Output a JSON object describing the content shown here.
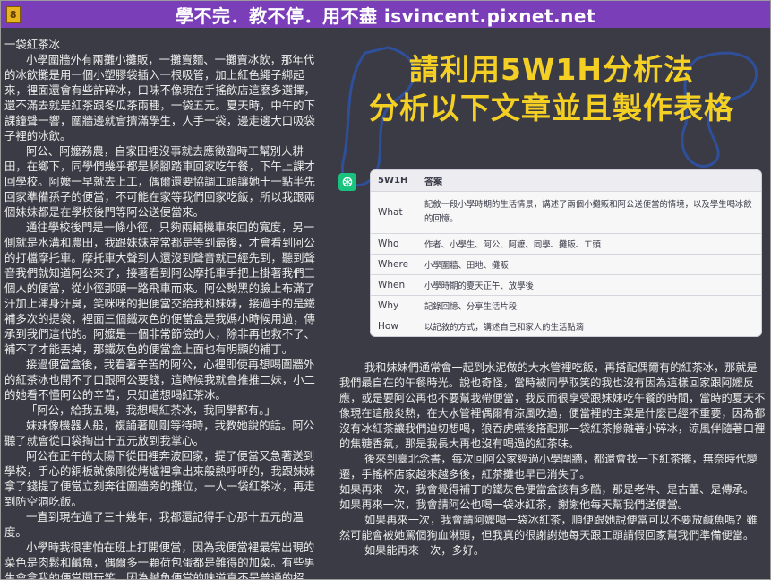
{
  "header": {
    "page_badge": "8",
    "title": "學不完．教不停．用不盡 isvincent.pixnet.net"
  },
  "left_article": {
    "title": "一袋紅茶冰",
    "paragraphs": [
      "小學圍牆外有兩攤小攤販，一攤賣麵、一攤賣冰飲，那年代的冰飲攤是用一個小塑膠袋插入一根吸管，加上紅色繩子綁起來，裡面還會有些許碎冰，口味不像現在手搖飲店這麼多選擇，還不滿去就是紅茶跟冬瓜茶兩種，一袋五元。夏天時，中午的下課鐘聲一響，圍牆邊就會擠滿學生，人手一袋，邊走邊大口吸袋子裡的冰飲。",
      "阿公、阿嬤務農，自家田裡沒事就去應徵臨時工幫別人耕田，在鄉下，同學們幾乎都是騎腳踏車回家吃午餐，下午上課才回學校。阿嬤一早就去上工，偶爾還要協調工頭讓她十一點半先回家準備孫子的便當，不可能在家等我們回家吃飯，所以我跟兩個妹妹都是在學校後門等阿公送便當來。",
      "通往學校後門是一條小徑，只夠兩輛機車來回的寬度，另一側就是水溝和農田，我跟妹妹常常都是等到最後，才會看到阿公的打檔摩托車。摩托車大聲到人還沒到聲音就已經先到，聽到聲音我們就知道阿公來了，接著看到阿公摩托車手把上掛著我們三個人的便當，從小徑那頭一路飛車而來。阿公黝黑的臉上布滿了汗加上渾身汗臭，笑咪咪的把便當交給我和妹妹，接過手的是鐵補多次的提袋，裡面三個鐵灰色的便當盒是我媽小時候用過，傳承到我們這代的。阿嬤是一個非常節儉的人，除非再也救不了、補不了才能丟掉，那鐵灰色的便當盒上面也有明顯的補丁。",
      "接過便當盒後，我看著辛苦的阿公，心裡即使再想喝圍牆外的紅茶冰也開不了口跟阿公要錢，這時候我就會推推二妹，小二的她看不懂阿公的辛苦，只知道想喝紅茶冰。",
      "「阿公，給我五塊，我想喝紅茶冰，我同學都有。」",
      "妹妹像機器人般，複誦著剛剛等待時，我教她說的話。阿公聽了就會從口袋掏出十五元放到我掌心。",
      "阿公在正午的太陽下從田裡奔波回家，提了便當又急著送到學校，手心的銅板就像剛從烤爐裡拿出來般熱呼呼的，我跟妹妹拿了錢提了便當立刻奔往圍牆旁的攤位，一人一袋紅茶冰，再走到防空洞吃飯。",
      "一直到現在過了三十幾年，我都還記得手心那十五元的溫度。",
      "小學時我很害怕在班上打開便當，因為我便當裡最常出現的菜色是肉鬆和鹹魚，偶爾多一顆荷包蛋都是難得的加菜。有些男生會拿我的便當開玩笑，因為鹹魚便當的味道真不是普通的招搖，一打開便當蓋，幾乎全班都可以聞到那股腥味。"
    ]
  },
  "prompt_title": {
    "line1": "請利用5W1H分析法",
    "line2": "分析以下文章並且製作表格"
  },
  "table": {
    "headers": [
      "5W1H",
      "答案"
    ],
    "rows": [
      {
        "k": "What",
        "v": "記敘一段小學時期的生活情景，講述了兩個小攤販和阿公送便當的情境，以及學生喝冰飲的回憶。"
      },
      {
        "k": "Who",
        "v": "作者、小學生、阿公、阿嬤、同學、攤販、工頭"
      },
      {
        "k": "Where",
        "v": "小學圍牆、田地、攤販"
      },
      {
        "k": "When",
        "v": "小學時期的夏天正午、放學後"
      },
      {
        "k": "Why",
        "v": "記錄回憶、分享生活片段"
      },
      {
        "k": "How",
        "v": "以記敘的方式，講述自己和家人的生活點滴"
      }
    ]
  },
  "right_article": {
    "paragraphs": [
      {
        "indent": true,
        "text": "我和妹妹們通常會一起到水泥做的大水管裡吃飯，再搭配偶爾有的紅茶冰，那就是我們最自在的午餐時光。說也奇怪，當時被同學取笑的我也沒有因為這樣回家跟阿嬤反應，或是要阿公再也不要幫我帶便當，我反而很享受跟妹妹吃午餐的時間，當時的夏天不像現在這般炎熱，在大水管裡偶爾有涼風吹過，便當裡的主菜是什麼已經不重要，因為都沒有冰紅茶讓我們迫切想喝，狼吞虎嚥後搭配那一袋紅茶摻雜著小碎冰，涼風伴隨著口裡的焦糖香氣，那是我長大再也沒有喝過的紅茶味。"
      },
      {
        "indent": true,
        "text": "後來到臺北念書，每次回阿公家經過小學圍牆，都還會找一下紅茶攤，無奈時代變遷，手搖杯店家越來越多後，紅茶攤也早已消失了。"
      },
      {
        "indent": false,
        "text": "如果再來一次，我會覺得補丁的鐵灰色便當盒該有多酷，那是老件、是古董、是傳承。"
      },
      {
        "indent": false,
        "text": "如果再來一次，我會請阿公也喝一袋冰紅茶，謝謝他每天幫我們送便當。"
      },
      {
        "indent": true,
        "text": "如果再來一次，我會請阿嬤喝一袋冰紅茶，順便跟她說便當可以不要放鹹魚嗎？雖然可能會被她罵個狗血淋頭，但我真的很謝謝她每天跟工頭請假回家幫我們準備便當。"
      },
      {
        "indent": true,
        "text": "如果能再來一次，多好。"
      }
    ]
  },
  "colors": {
    "header_bg": "#7a3fb8",
    "title_yellow": "#f4cf24",
    "background": "#3b3b45",
    "gpt_green": "#19c37d",
    "deco_blue": "#2f4f9a"
  },
  "icons": {
    "page_badge": "page-badge-icon",
    "assistant": "chatgpt-logo-icon"
  }
}
